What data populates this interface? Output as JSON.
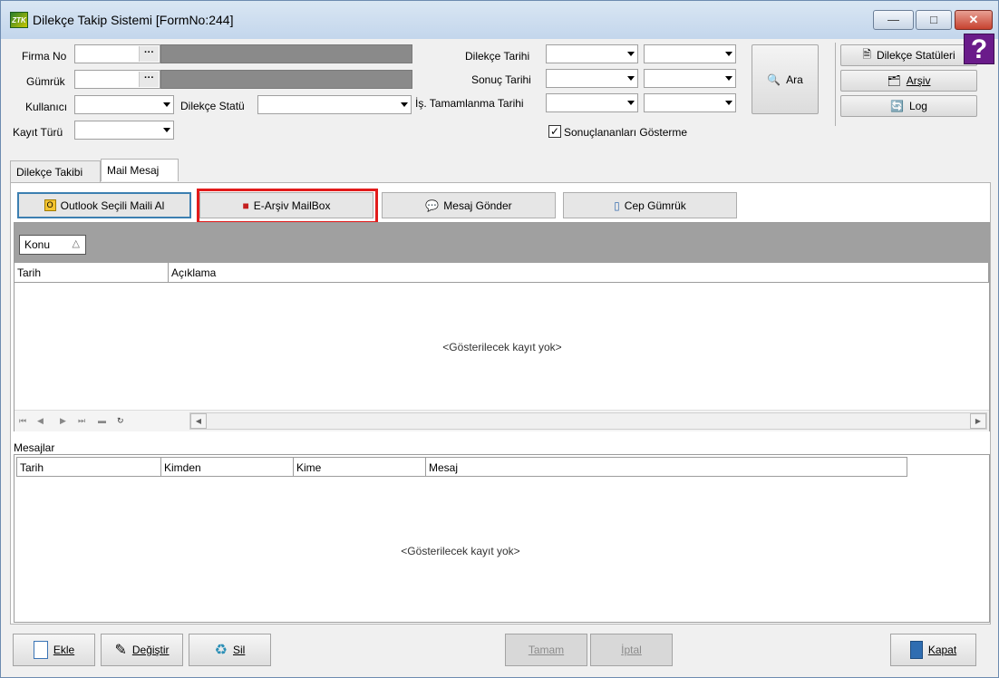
{
  "window": {
    "title": "Dilekçe Takip Sistemi [FormNo:244]",
    "app_icon_text": "ZTK"
  },
  "window_buttons": {
    "minimize": "—",
    "maximize": "□",
    "close": "✕"
  },
  "help_icon": "?",
  "filters": {
    "firma_no": "Firma No",
    "gumruk": "Gümrük",
    "kullanici": "Kullanıcı",
    "kayit_turu": "Kayıt Türü",
    "dilekce_statu": "Dilekçe Statü",
    "dilekce_tarihi": "Dilekçe Tarihi",
    "sonuc_tarihi": "Sonuç Tarihi",
    "is_tamamlanma_tarihi": "İş. Tamamlanma Tarihi",
    "sonuclananlari_gosterme": "Sonuçlananları Gösterme",
    "ellipsis": "···"
  },
  "actions": {
    "ara": "Ara",
    "dilekce_statuleri": "Dilekçe Statüleri",
    "arsiv": "Arşiv",
    "log": "Log"
  },
  "tabs": [
    {
      "label": "Dilekçe Takibi"
    },
    {
      "label": "Mail Mesaj"
    }
  ],
  "mail_toolbar": {
    "outlook": "Outlook Seçili Maili Al",
    "earsiv": "E-Arşiv MailBox",
    "mesaj_gonder": "Mesaj Gönder",
    "cep_gumruk": "Cep Gümrük"
  },
  "grid1": {
    "group_column": "Konu",
    "columns": [
      "Tarih",
      "Açıklama"
    ],
    "empty_text": "<Gösterilecek kayıt yok>"
  },
  "messages_section": {
    "label": "Mesajlar",
    "columns": [
      "Tarih",
      "Kimden",
      "Kime",
      "Mesaj"
    ],
    "empty_text": "<Gösterilecek kayıt yok>"
  },
  "bottom_buttons": {
    "ekle": "Ekle",
    "degistir": "Değiştir",
    "sil": "Sil",
    "tamam": "Tamam",
    "iptal": "İptal",
    "kapat": "Kapat"
  }
}
